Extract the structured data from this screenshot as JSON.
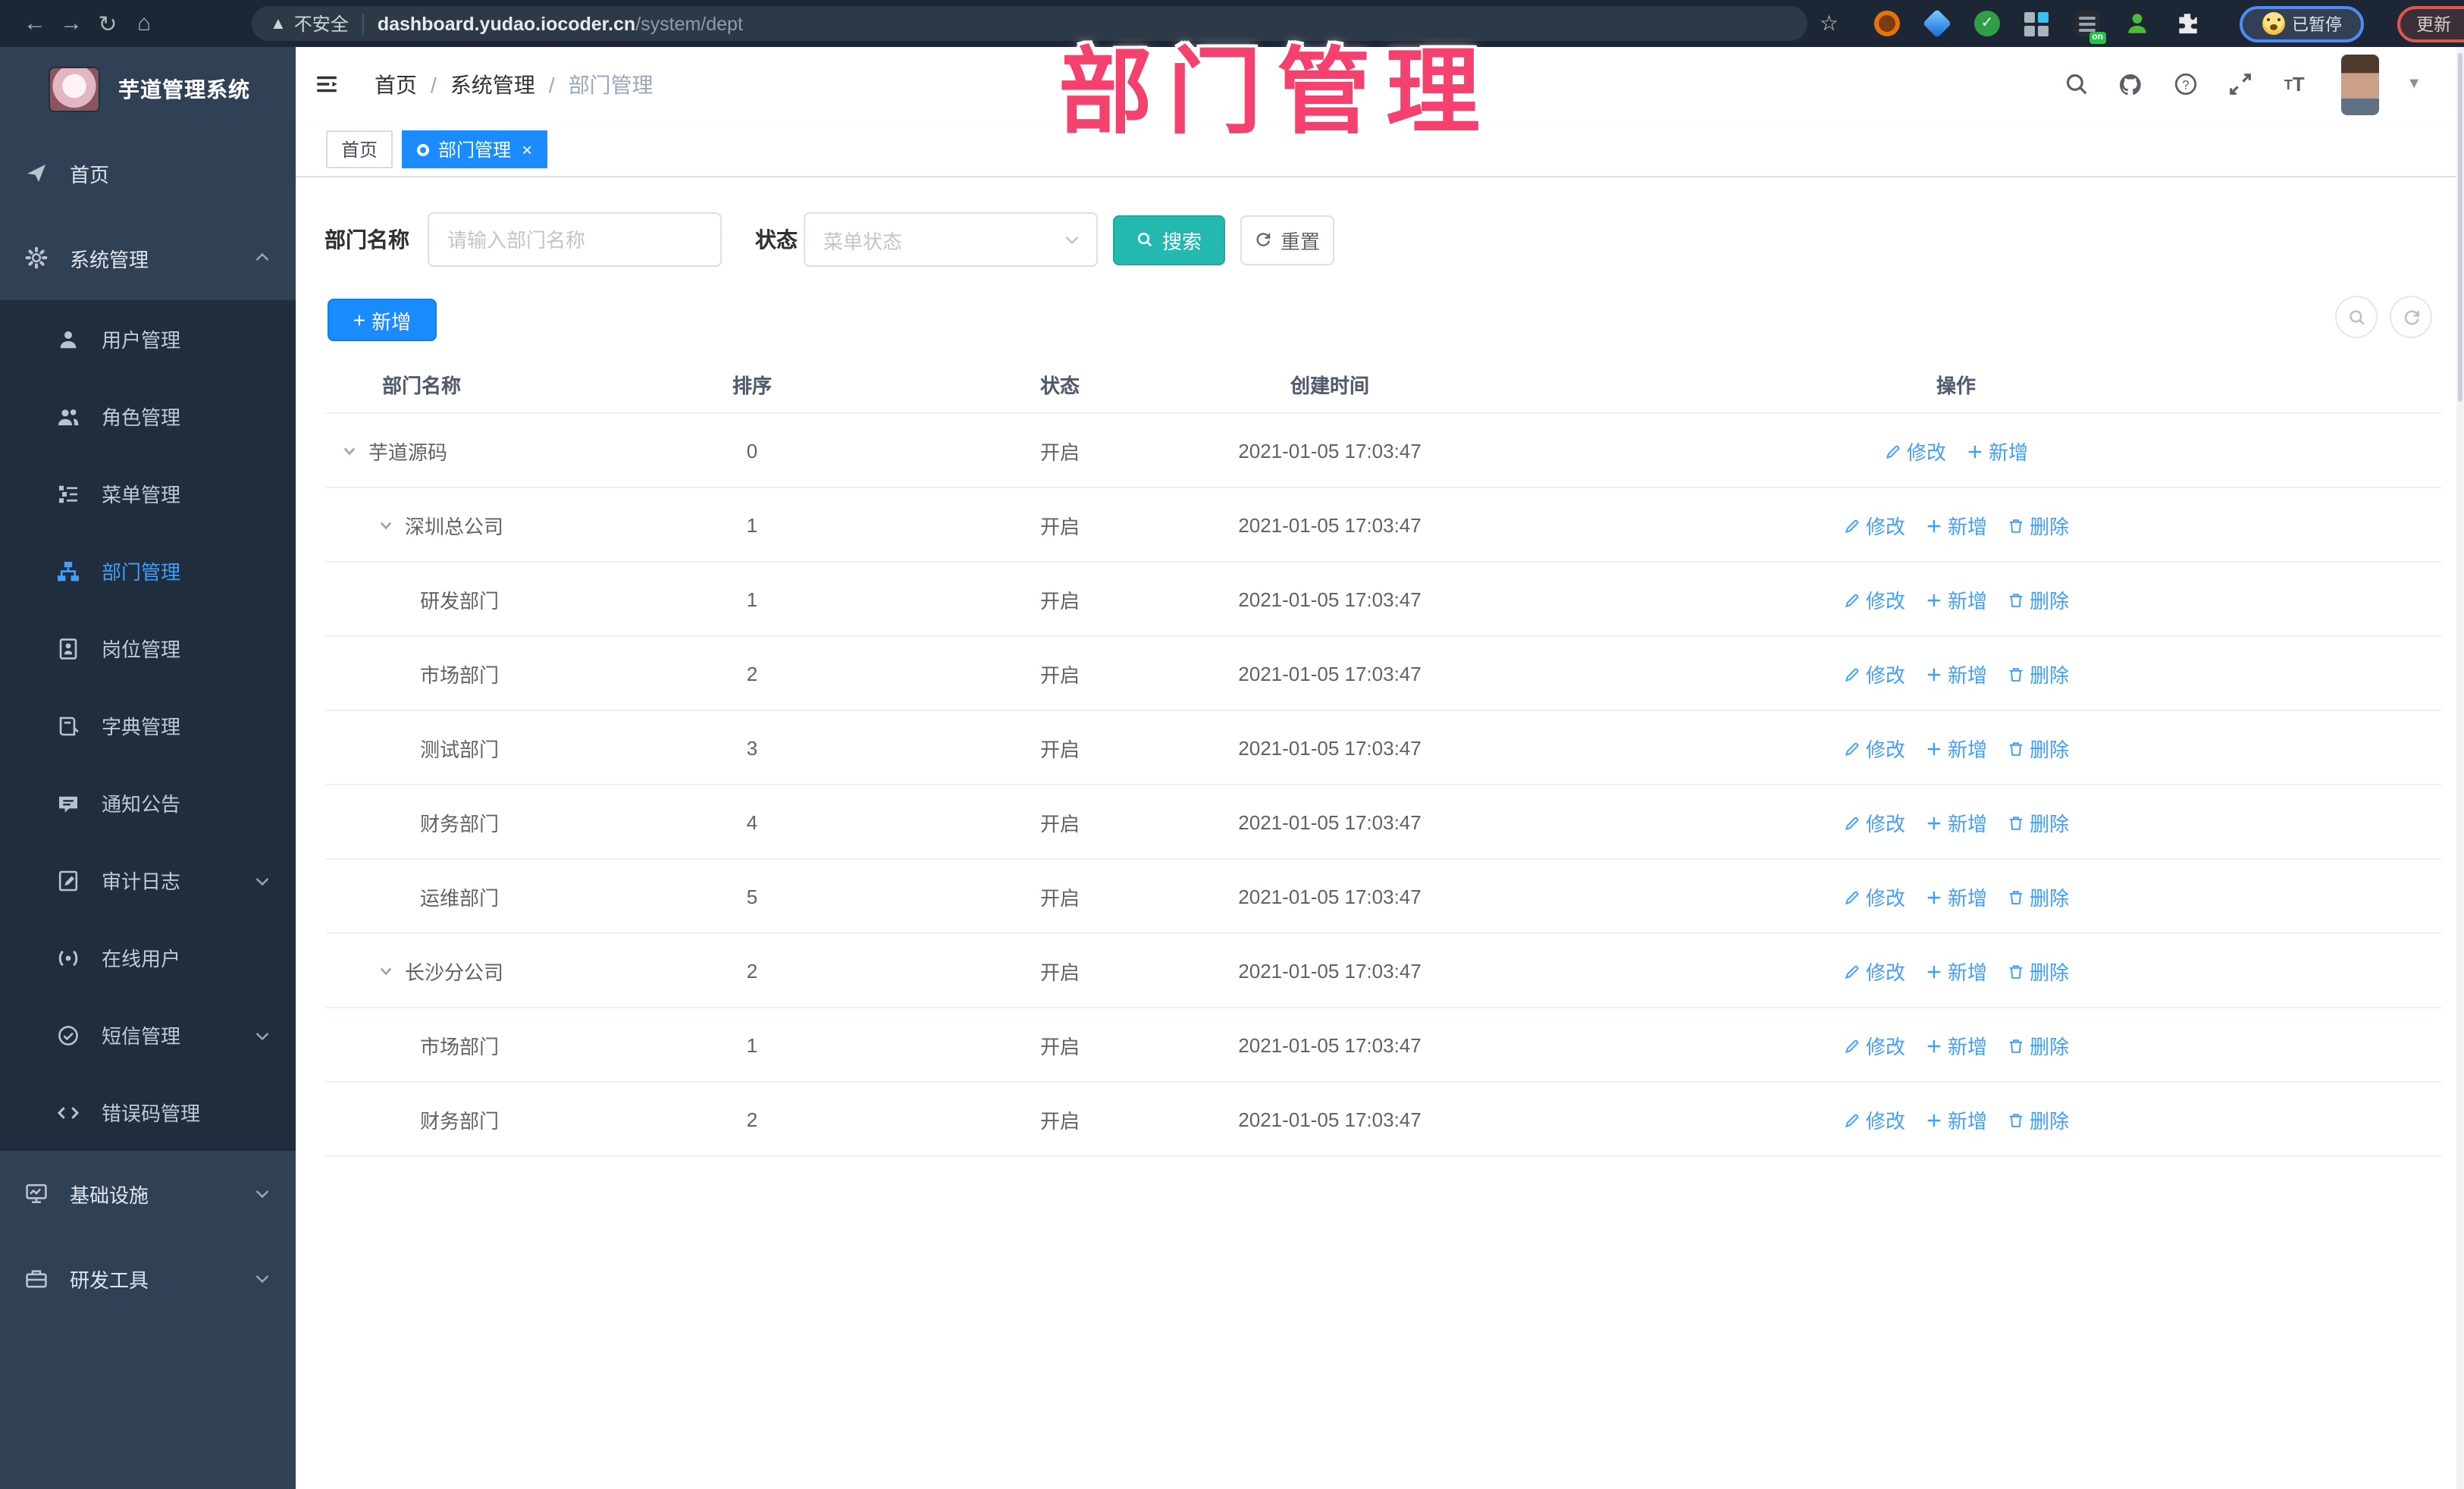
{
  "browser": {
    "security_label": "不安全",
    "url_host": "dashboard.yudao.iocoder.cn",
    "url_path": "/system/dept",
    "paused_label": "已暂停",
    "update_label": "更新"
  },
  "watermark": "部门管理",
  "sidebar": {
    "title": "芋道管理系统",
    "items": [
      {
        "label": "首页",
        "icon": "guide-icon",
        "type": "top"
      },
      {
        "label": "系统管理",
        "icon": "gear-icon",
        "type": "top",
        "chevron": "up"
      },
      {
        "label": "用户管理",
        "icon": "user-icon",
        "type": "sub"
      },
      {
        "label": "角色管理",
        "icon": "users-icon",
        "type": "sub"
      },
      {
        "label": "菜单管理",
        "icon": "menu-tree-icon",
        "type": "sub"
      },
      {
        "label": "部门管理",
        "icon": "org-tree-icon",
        "type": "sub",
        "active": true
      },
      {
        "label": "岗位管理",
        "icon": "badge-icon",
        "type": "sub"
      },
      {
        "label": "字典管理",
        "icon": "book-icon",
        "type": "sub"
      },
      {
        "label": "通知公告",
        "icon": "megaphone-icon",
        "type": "sub"
      },
      {
        "label": "审计日志",
        "icon": "log-icon",
        "type": "sub",
        "chevron": "down"
      },
      {
        "label": "在线用户",
        "icon": "online-icon",
        "type": "sub"
      },
      {
        "label": "短信管理",
        "icon": "sms-icon",
        "type": "sub",
        "chevron": "down"
      },
      {
        "label": "错误码管理",
        "icon": "code-icon",
        "type": "sub"
      },
      {
        "label": "基础设施",
        "icon": "monitor-icon",
        "type": "top",
        "chevron": "down"
      },
      {
        "label": "研发工具",
        "icon": "toolbox-icon",
        "type": "top",
        "chevron": "down"
      }
    ]
  },
  "header": {
    "breadcrumb": [
      "首页",
      "系统管理",
      "部门管理"
    ]
  },
  "tabs": [
    {
      "label": "首页",
      "active": false,
      "closable": false
    },
    {
      "label": "部门管理",
      "active": true,
      "closable": true
    }
  ],
  "filters": {
    "name_label": "部门名称",
    "name_placeholder": "请输入部门名称",
    "status_label": "状态",
    "status_placeholder": "菜单状态",
    "search_label": "搜索",
    "reset_label": "重置"
  },
  "toolbar": {
    "add_label": "新增"
  },
  "table": {
    "columns": [
      "部门名称",
      "排序",
      "状态",
      "创建时间",
      "操作"
    ],
    "op_labels": [
      "修改",
      "新增",
      "删除"
    ],
    "rows": [
      {
        "name": "芋道源码",
        "level": 0,
        "caret": true,
        "sort": "0",
        "status": "开启",
        "time": "2021-01-05 17:03:47",
        "ops": [
          "修改",
          "新增"
        ]
      },
      {
        "name": "深圳总公司",
        "level": 1,
        "caret": true,
        "sort": "1",
        "status": "开启",
        "time": "2021-01-05 17:03:47",
        "ops": [
          "修改",
          "新增",
          "删除"
        ]
      },
      {
        "name": "研发部门",
        "level": 2,
        "caret": false,
        "sort": "1",
        "status": "开启",
        "time": "2021-01-05 17:03:47",
        "ops": [
          "修改",
          "新增",
          "删除"
        ]
      },
      {
        "name": "市场部门",
        "level": 2,
        "caret": false,
        "sort": "2",
        "status": "开启",
        "time": "2021-01-05 17:03:47",
        "ops": [
          "修改",
          "新增",
          "删除"
        ]
      },
      {
        "name": "测试部门",
        "level": 2,
        "caret": false,
        "sort": "3",
        "status": "开启",
        "time": "2021-01-05 17:03:47",
        "ops": [
          "修改",
          "新增",
          "删除"
        ]
      },
      {
        "name": "财务部门",
        "level": 2,
        "caret": false,
        "sort": "4",
        "status": "开启",
        "time": "2021-01-05 17:03:47",
        "ops": [
          "修改",
          "新增",
          "删除"
        ]
      },
      {
        "name": "运维部门",
        "level": 2,
        "caret": false,
        "sort": "5",
        "status": "开启",
        "time": "2021-01-05 17:03:47",
        "ops": [
          "修改",
          "新增",
          "删除"
        ]
      },
      {
        "name": "长沙分公司",
        "level": 1,
        "caret": true,
        "sort": "2",
        "status": "开启",
        "time": "2021-01-05 17:03:47",
        "ops": [
          "修改",
          "新增",
          "删除"
        ]
      },
      {
        "name": "市场部门",
        "level": 2,
        "caret": false,
        "sort": "1",
        "status": "开启",
        "time": "2021-01-05 17:03:47",
        "ops": [
          "修改",
          "新增",
          "删除"
        ]
      },
      {
        "name": "财务部门",
        "level": 2,
        "caret": false,
        "sort": "2",
        "status": "开启",
        "time": "2021-01-05 17:03:47",
        "ops": [
          "修改",
          "新增",
          "删除"
        ]
      }
    ]
  },
  "colors": {
    "accent_blue": "#1a8cff",
    "link_blue": "#409eff",
    "search_teal": "#23b8b0",
    "watermark_pink": "#f4416d",
    "sidebar_bg": "#304156",
    "submenu_bg": "#1f2d3d",
    "browser_bar_bg": "#1d2634"
  }
}
